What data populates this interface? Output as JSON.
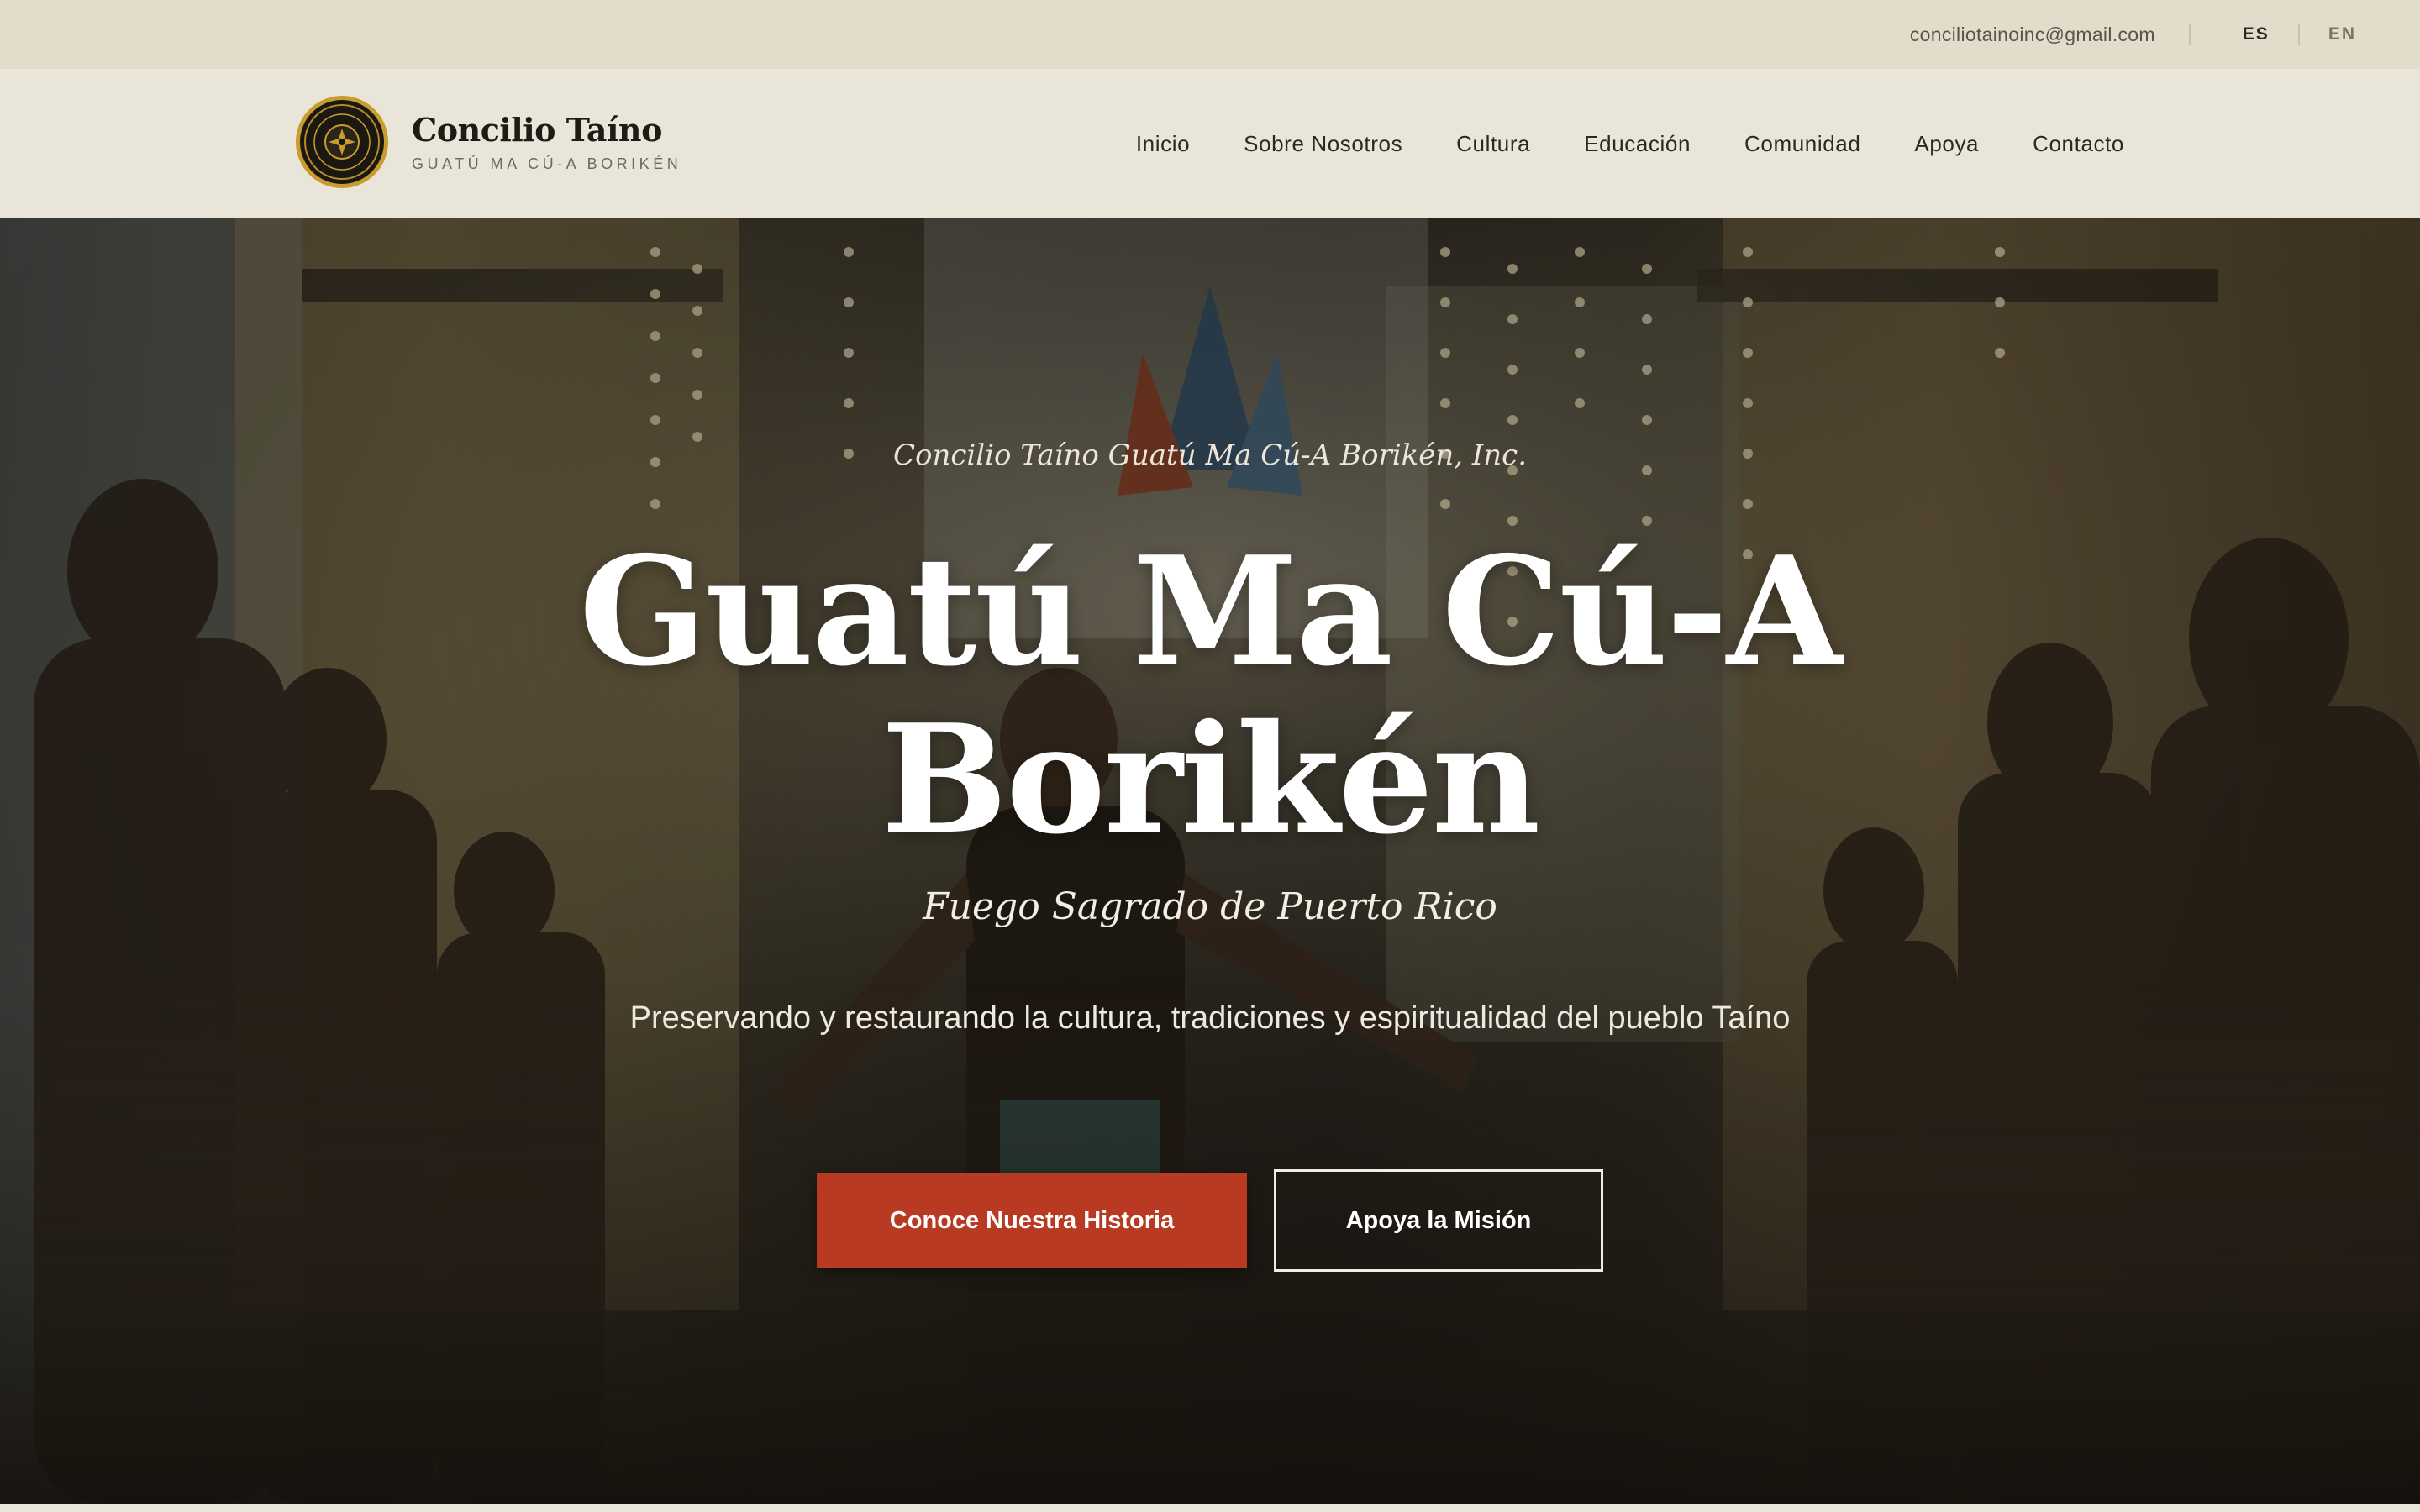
{
  "topbar": {
    "email": "conciliotainoinc@gmail.com",
    "languages": [
      "ES",
      "EN"
    ],
    "active_language": "ES"
  },
  "header": {
    "logo_icon": "circular-emblem-icon",
    "title": "Concilio Taíno",
    "subtitle": "GUATÚ MA CÚ-A BORIKÉN"
  },
  "nav": {
    "items": [
      "Inicio",
      "Sobre Nosotros",
      "Cultura",
      "Educación",
      "Comunidad",
      "Apoya",
      "Contacto"
    ]
  },
  "hero": {
    "org_line": "Concilio Taíno Guatú Ma Cú-A Borikén, Inc.",
    "title_line1": "Guatú Ma Cú-A",
    "title_line2": "Borikén",
    "tagline": "Fuego Sagrado de Puerto Rico",
    "description": "Preservando y restaurando la cultura, tradiciones y espiritualidad del pueblo Taíno",
    "primary_button": "Conoce Nuestra Historia",
    "secondary_button": "Apoya la Misión"
  },
  "colors": {
    "accent": "#b83a22",
    "topbar_bg": "#e2dccb",
    "header_bg": "#e9e5d8",
    "logo_ring": "#c99c2e"
  }
}
